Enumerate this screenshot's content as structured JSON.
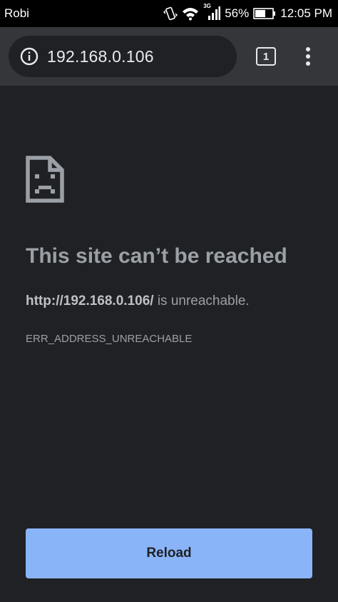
{
  "status_bar": {
    "carrier": "Robi",
    "network_type": "3G",
    "battery": "56%",
    "time": "12:05 PM",
    "icons": [
      "vibrate-icon",
      "wifi-icon",
      "signal-icon",
      "battery-icon"
    ]
  },
  "toolbar": {
    "url": "192.168.0.106",
    "tab_count": "1",
    "icons": [
      "info-icon",
      "tab-switcher-icon",
      "more-menu-icon"
    ]
  },
  "error": {
    "icon": "sad-page-icon",
    "title": "This site can’t be reached",
    "url_bold": "http://192.168.0.106/",
    "message_suffix": " is unreachable.",
    "code": "ERR_ADDRESS_UNREACHABLE"
  },
  "reload_button": {
    "label": "Reload"
  },
  "colors": {
    "background": "#202124",
    "toolbar": "#35363a",
    "accent": "#8ab4f8",
    "text_muted": "#9aa0a6"
  }
}
